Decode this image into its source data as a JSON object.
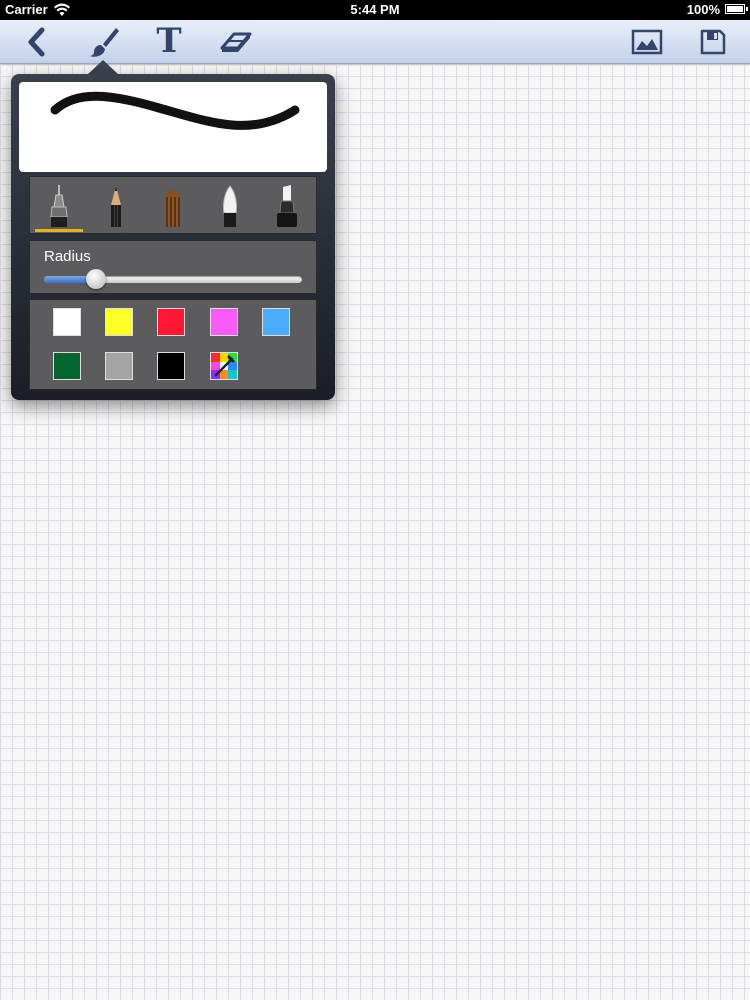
{
  "status_bar": {
    "carrier": "Carrier",
    "time": "5:44 PM",
    "battery": "100%"
  },
  "toolbar": {
    "icons": [
      "back-chevron-icon",
      "paintbrush-icon",
      "text-tool-icon",
      "eraser-icon",
      "image-icon",
      "save-icon"
    ],
    "text_tool_glyph": "T",
    "icon_color": "#33456b"
  },
  "brush_popover": {
    "brushes": [
      {
        "name": "technical-pen-icon",
        "selected": true
      },
      {
        "name": "pencil-icon",
        "selected": false
      },
      {
        "name": "crayon-icon",
        "selected": false
      },
      {
        "name": "round-brush-icon",
        "selected": false
      },
      {
        "name": "marker-icon",
        "selected": false
      }
    ],
    "radius_label": "Radius",
    "radius_value": 0.2,
    "colors": [
      {
        "name": "white",
        "hex": "#ffffff"
      },
      {
        "name": "yellow",
        "hex": "#ffff27"
      },
      {
        "name": "red",
        "hex": "#ff1633"
      },
      {
        "name": "magenta",
        "hex": "#f75af9"
      },
      {
        "name": "light-blue",
        "hex": "#4aacfb"
      },
      {
        "name": "dark-green",
        "hex": "#03642d"
      },
      {
        "name": "gray",
        "hex": "#a4a4a4"
      },
      {
        "name": "black",
        "hex": "#000000"
      },
      {
        "name": "custom-color-picker",
        "hex": "multicolor"
      }
    ]
  }
}
